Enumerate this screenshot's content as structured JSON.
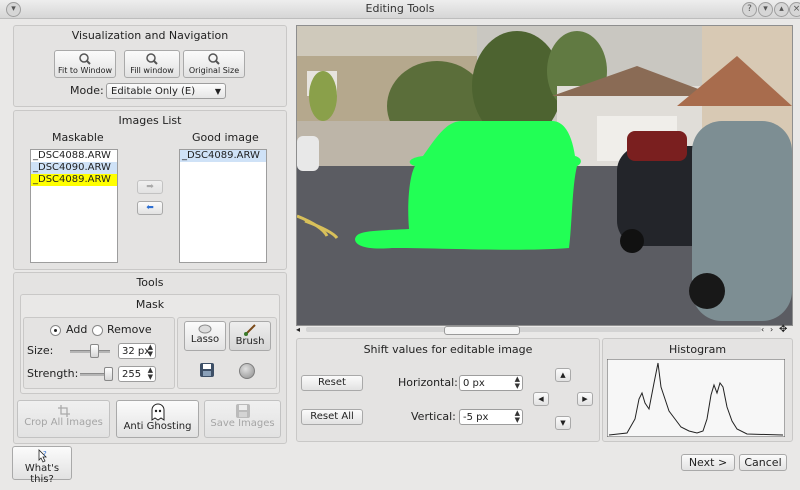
{
  "window": {
    "title": "Editing Tools"
  },
  "visualization": {
    "title": "Visualization and Navigation",
    "fit_to_window": "Fit to Window",
    "fill_window": "Fill window",
    "original_size": "Original Size",
    "mode_label": "Mode:",
    "mode_value": "Editable Only (E)"
  },
  "images_list": {
    "title": "Images List",
    "maskable_header": "Maskable",
    "good_header": "Good image",
    "maskable_items": [
      "_DSC4088.ARW",
      "_DSC4090.ARW",
      "_DSC4089.ARW"
    ],
    "good_items": [
      "_DSC4089.ARW"
    ]
  },
  "tools": {
    "title": "Tools",
    "mask_title": "Mask",
    "add_label": "Add",
    "remove_label": "Remove",
    "size_label": "Size:",
    "size_value": "32 px",
    "strength_label": "Strength:",
    "strength_value": "255",
    "lasso_label": "Lasso",
    "brush_label": "Brush"
  },
  "actions": {
    "crop_all": "Crop All Images",
    "anti_ghosting": "Anti Ghosting",
    "save_images": "Save Images"
  },
  "shift": {
    "title": "Shift values for editable image",
    "reset": "Reset",
    "reset_all": "Reset All",
    "horizontal_label": "Horizontal:",
    "horizontal_value": "0 px",
    "vertical_label": "Vertical:",
    "vertical_value": "-5 px"
  },
  "histogram": {
    "title": "Histogram"
  },
  "footer": {
    "whats_this": "What's this?",
    "next": "Next >",
    "cancel": "Cancel"
  },
  "colors": {
    "mask_green": "#22ff55",
    "highlight_yellow": "#ffff00",
    "selection_blue": "#cfe2f7"
  }
}
